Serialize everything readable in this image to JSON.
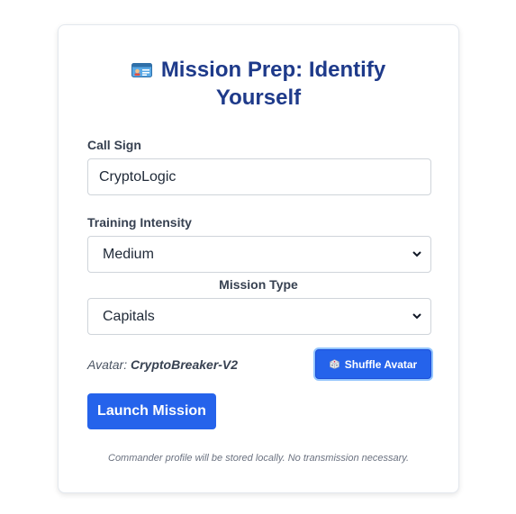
{
  "title": {
    "line1": "Mission Prep: Identify",
    "line2": "Yourself",
    "icon": "id-card-icon"
  },
  "call_sign": {
    "label": "Call Sign",
    "value": "CryptoLogic"
  },
  "training_intensity": {
    "label": "Training Intensity",
    "selected": "Medium"
  },
  "mission_type": {
    "label": "Mission Type",
    "selected": "Capitals"
  },
  "avatar": {
    "prefix": "Avatar:",
    "name": "CryptoBreaker-V2"
  },
  "shuffle_button": {
    "label": "Shuffle Avatar",
    "icon": "dice-icon"
  },
  "launch_button": {
    "label": "Launch Mission"
  },
  "footnote": "Commander profile will be stored locally. No transmission necessary.",
  "colors": {
    "title": "#1e3a8a",
    "primary": "#2563eb",
    "label": "#374151",
    "muted": "#6b7280"
  }
}
